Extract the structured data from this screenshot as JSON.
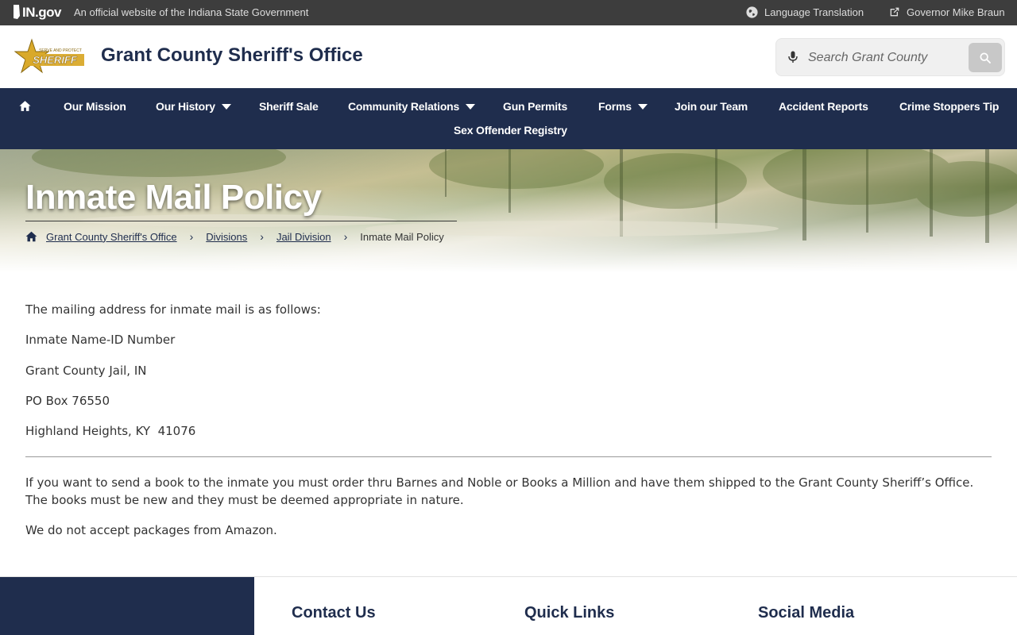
{
  "topbar": {
    "ingov_label": "IN.gov",
    "official_text": "An official website of the Indiana State Government",
    "language_label": "Language Translation",
    "governor_label": "Governor Mike Braun"
  },
  "header": {
    "site_title": "Grant County Sheriff's Office",
    "logo_text": "SHERIFF",
    "logo_tagline": "SERVE AND PROTECT",
    "search_placeholder": "Search Grant County"
  },
  "nav": {
    "items": [
      {
        "label": "Our Mission"
      },
      {
        "label": "Our History"
      },
      {
        "label": "Sheriff Sale"
      },
      {
        "label": "Community Relations"
      },
      {
        "label": "Gun Permits"
      },
      {
        "label": "Forms"
      },
      {
        "label": "Join our Team"
      },
      {
        "label": "Accident Reports"
      },
      {
        "label": "Crime Stoppers Tip"
      },
      {
        "label": "Sex Offender Registry"
      }
    ]
  },
  "banner": {
    "page_title": "Inmate Mail Policy",
    "breadcrumb": [
      {
        "label": "Grant County Sheriff's Office"
      },
      {
        "label": "Divisions"
      },
      {
        "label": "Jail Division"
      },
      {
        "label": "Inmate Mail Policy"
      }
    ]
  },
  "content": {
    "intro": "The mailing address for inmate mail is as follows:",
    "address": [
      "Inmate Name-ID Number",
      "Grant County Jail, IN",
      "PO Box 76550",
      "Highland Heights, KY  41076"
    ],
    "books_para": "If you want to send a book to the inmate you must order thru Barnes and Noble or Books a Million and have them shipped to the Grant County Sheriff’s Office. The books must be new and they must be deemed appropriate in nature.",
    "amazon_para": "We do not accept packages from Amazon."
  },
  "footer": {
    "contact_heading": "Contact Us",
    "quicklinks_heading": "Quick Links",
    "social_heading": "Social Media"
  },
  "colors": {
    "navy": "#1f2d4d",
    "topbar": "#3d3d3d",
    "logo_gold": "#d9a92a"
  }
}
